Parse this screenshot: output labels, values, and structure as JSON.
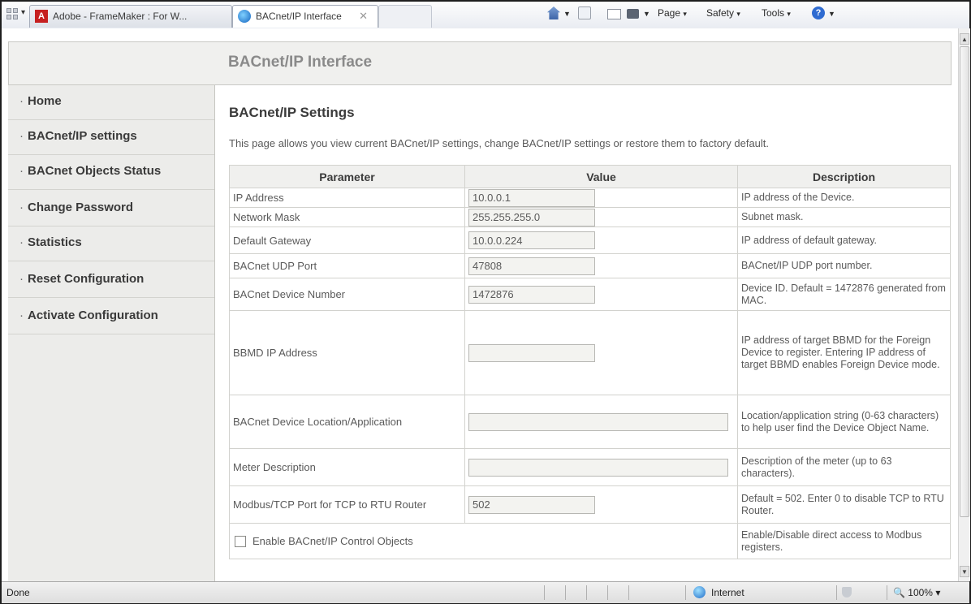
{
  "browser": {
    "tabs": [
      {
        "title": "Adobe - FrameMaker : For W..."
      },
      {
        "title": "BACnet/IP Interface"
      }
    ],
    "command_bar": {
      "page_label": "Page",
      "safety_label": "Safety",
      "tools_label": "Tools"
    }
  },
  "header": {
    "title": "BACnet/IP Interface"
  },
  "sidebar": {
    "items": [
      {
        "label": "Home"
      },
      {
        "label": "BACnet/IP settings"
      },
      {
        "label": "BACnet Objects Status"
      },
      {
        "label": "Change Password"
      },
      {
        "label": "Statistics"
      },
      {
        "label": "Reset Configuration"
      },
      {
        "label": "Activate Configuration"
      }
    ]
  },
  "main": {
    "title": "BACnet/IP Settings",
    "intro": "This page allows you view current BACnet/IP settings, change BACnet/IP settings or restore them to factory default.",
    "table": {
      "headers": [
        "Parameter",
        "Value",
        "Description"
      ],
      "rows": [
        {
          "param": "IP Address",
          "value": "10.0.0.1",
          "desc": "IP address of the Device."
        },
        {
          "param": "Network Mask",
          "value": "255.255.255.0",
          "desc": "Subnet mask."
        },
        {
          "param": "Default Gateway",
          "value": "10.0.0.224",
          "desc": "IP address of default gateway."
        },
        {
          "param": "BACnet UDP Port",
          "value": "47808",
          "desc": "BACnet/IP UDP port number."
        },
        {
          "param": "BACnet Device Number",
          "value": "1472876",
          "desc": "Device ID. Default = 1472876 generated from MAC."
        },
        {
          "param": "BBMD IP Address",
          "value": "",
          "desc": "IP address of target BBMD for the Foreign Device to register. Entering IP address of target BBMD enables Foreign Device mode."
        },
        {
          "param": "BACnet Device Location/Application",
          "value": "",
          "desc": "Location/application string (0-63 characters) to help user find the Device Object Name."
        },
        {
          "param": "Meter Description",
          "value": "",
          "desc": "Description of the meter (up to 63 characters)."
        },
        {
          "param": "Modbus/TCP Port for TCP to RTU Router",
          "value": "502",
          "desc": "Default = 502. Enter 0 to disable TCP to RTU Router."
        },
        {
          "param": "Enable BACnet/IP Control Objects",
          "checked": false,
          "desc": "Enable/Disable direct access to Modbus registers."
        }
      ]
    }
  },
  "status_bar": {
    "status": "Done",
    "zone": "Internet",
    "zoom": "100%"
  }
}
